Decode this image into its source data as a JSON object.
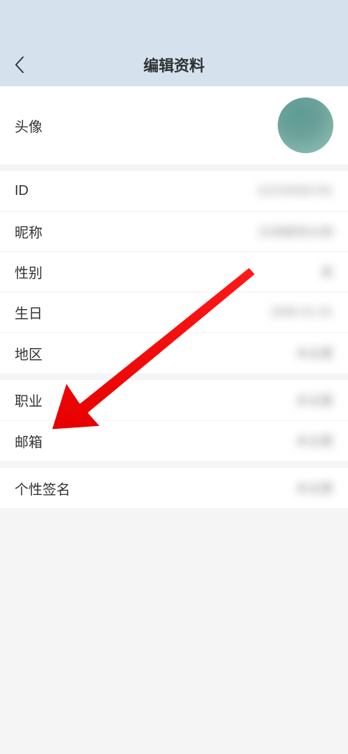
{
  "header": {
    "title": "编辑资料"
  },
  "avatar": {
    "label": "头像"
  },
  "group1": [
    {
      "label": "ID",
      "value": "10234056781"
    },
    {
      "label": "昵称",
      "value": "示例昵称示例"
    },
    {
      "label": "性别",
      "value": "男"
    },
    {
      "label": "生日",
      "value": "1990-01-01"
    },
    {
      "label": "地区",
      "value": "未设置"
    }
  ],
  "group2": [
    {
      "label": "职业",
      "value": "未设置"
    },
    {
      "label": "邮箱",
      "value": "未设置"
    }
  ],
  "group3": [
    {
      "label": "个性签名",
      "value": "未设置"
    }
  ]
}
